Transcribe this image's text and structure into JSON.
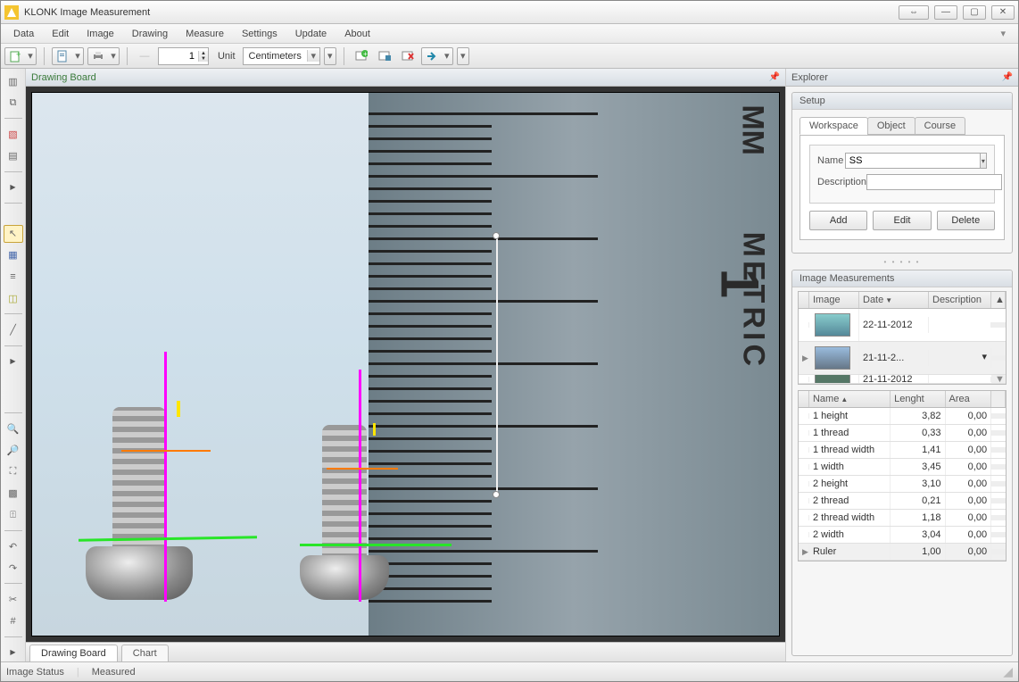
{
  "app": {
    "title": "KLONK Image Measurement"
  },
  "menu": {
    "items": [
      "Data",
      "Edit",
      "Image",
      "Drawing",
      "Measure",
      "Settings",
      "Update",
      "About"
    ]
  },
  "toolbar": {
    "spin_value": "1",
    "unit_label": "Unit",
    "unit_value": "Centimeters"
  },
  "drawing_board": {
    "title": "Drawing Board"
  },
  "bottom_tabs": {
    "t1": "Drawing Board",
    "t2": "Chart"
  },
  "explorer": {
    "title": "Explorer",
    "setup": {
      "title": "Setup",
      "tabs": {
        "workspace": "Workspace",
        "object": "Object",
        "course": "Course"
      },
      "name_label": "Name",
      "name_value": "SS",
      "desc_label": "Description",
      "desc_value": "",
      "add": "Add",
      "edit": "Edit",
      "delete": "Delete"
    },
    "images": {
      "title": "Image Measurements",
      "cols": {
        "image": "Image",
        "date": "Date",
        "desc": "Description"
      },
      "rows": [
        {
          "date": "22-11-2012",
          "desc": ""
        },
        {
          "date": "21-11-2...",
          "desc": ""
        },
        {
          "date": "21-11-2012",
          "desc": ""
        }
      ]
    },
    "measure": {
      "cols": {
        "name": "Name",
        "length": "Lenght",
        "area": "Area"
      },
      "rows": [
        {
          "name": "1 height",
          "len": "3,82",
          "area": "0,00"
        },
        {
          "name": "1 thread",
          "len": "0,33",
          "area": "0,00"
        },
        {
          "name": "1 thread width",
          "len": "1,41",
          "area": "0,00"
        },
        {
          "name": "1 width",
          "len": "3,45",
          "area": "0,00"
        },
        {
          "name": "2 height",
          "len": "3,10",
          "area": "0,00"
        },
        {
          "name": "2 thread",
          "len": "0,21",
          "area": "0,00"
        },
        {
          "name": "2 thread width",
          "len": "1,18",
          "area": "0,00"
        },
        {
          "name": "2 width",
          "len": "3,04",
          "area": "0,00"
        },
        {
          "name": "Ruler",
          "len": "1,00",
          "area": "0,00"
        }
      ]
    }
  },
  "statusbar": {
    "s1": "Image Status",
    "s2": "Measured"
  }
}
